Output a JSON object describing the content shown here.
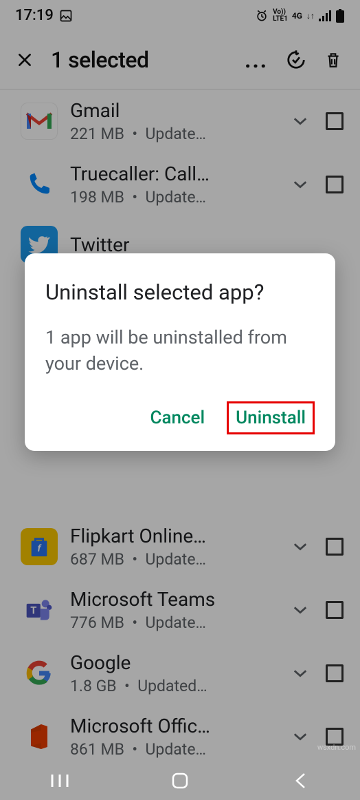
{
  "status": {
    "time": "17:19",
    "network": "4G"
  },
  "header": {
    "title": "1 selected"
  },
  "apps": [
    {
      "name": "Gmail",
      "size": "221 MB",
      "status": "Update…"
    },
    {
      "name": "Truecaller: Call…",
      "size": "198 MB",
      "status": "Update…"
    },
    {
      "name": "Twitter",
      "size": "",
      "status": ""
    },
    {
      "name": "Flipkart Online…",
      "size": "687 MB",
      "status": "Update…"
    },
    {
      "name": "Microsoft Teams",
      "size": "776 MB",
      "status": "Update…"
    },
    {
      "name": "Google",
      "size": "1.8 GB",
      "status": "Updated…"
    },
    {
      "name": "Microsoft Offic…",
      "size": "861 MB",
      "status": "Update…"
    }
  ],
  "dialog": {
    "title": "Uninstall selected app?",
    "body": "1 app will be uninstalled from your device.",
    "cancel": "Cancel",
    "confirm": "Uninstall"
  },
  "watermark": "wsxdn.com"
}
